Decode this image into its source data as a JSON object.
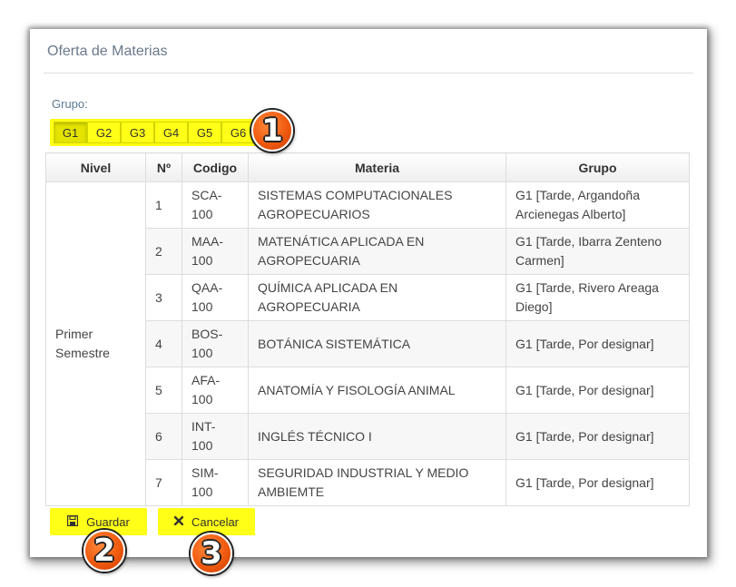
{
  "panel": {
    "title": "Oferta de Materias"
  },
  "group_label": "Grupo:",
  "groups": [
    "G1",
    "G2",
    "G3",
    "G4",
    "G5",
    "G6"
  ],
  "active_group": "G1",
  "table": {
    "headers": [
      "Nivel",
      "Nº",
      "Codigo",
      "Materia",
      "Grupo"
    ],
    "nivel_line1": "Primer",
    "nivel_line2": "Semestre",
    "rows": [
      {
        "num": "1",
        "code1": "SCA-",
        "code2": "100",
        "materia1": "SISTEMAS COMPUTACIONALES",
        "materia2": "AGROPECUARIOS",
        "grupo1": "G1 [Tarde, Argandoña",
        "grupo2": "Arcienegas Alberto]"
      },
      {
        "num": "2",
        "code1": "MAA-",
        "code2": "100",
        "materia1": "MATENÁTICA APLICADA EN",
        "materia2": "AGROPECUARIA",
        "grupo1": "G1 [Tarde, Ibarra Zenteno",
        "grupo2": "Carmen]"
      },
      {
        "num": "3",
        "code1": "QAA-",
        "code2": "100",
        "materia1": "QUÍMICA APLICADA EN",
        "materia2": "AGROPECUARIA",
        "grupo1": "G1 [Tarde, Rivero Areaga",
        "grupo2": "Diego]"
      },
      {
        "num": "4",
        "code1": "BOS-",
        "code2": "100",
        "materia1": "BOTÁNICA SISTEMÁTICA",
        "materia2": "",
        "grupo1": "G1 [Tarde, Por designar]",
        "grupo2": ""
      },
      {
        "num": "5",
        "code1": "AFA-",
        "code2": "100",
        "materia1": "ANATOMÍA Y FISOLOGÍA ANIMAL",
        "materia2": "",
        "grupo1": "G1 [Tarde, Por designar]",
        "grupo2": ""
      },
      {
        "num": "6",
        "code1": "INT-",
        "code2": "100",
        "materia1": "INGLÉS TÉCNICO I",
        "materia2": "",
        "grupo1": "G1 [Tarde, Por designar]",
        "grupo2": ""
      },
      {
        "num": "7",
        "code1": "SIM-",
        "code2": "100",
        "materia1": "SEGURIDAD INDUSTRIAL Y MEDIO",
        "materia2": "AMBIEMTE",
        "grupo1": "G1 [Tarde, Por designar]",
        "grupo2": ""
      }
    ]
  },
  "buttons": {
    "save_label": "Guardar",
    "save_icon": "floppy-disk-icon",
    "cancel_label": "Cancelar",
    "cancel_icon": "close-icon"
  },
  "badges": [
    "1",
    "2",
    "3"
  ],
  "colors": {
    "highlight": "#ffff17",
    "badge": "#f05a10",
    "title": "#6a7a8c"
  }
}
